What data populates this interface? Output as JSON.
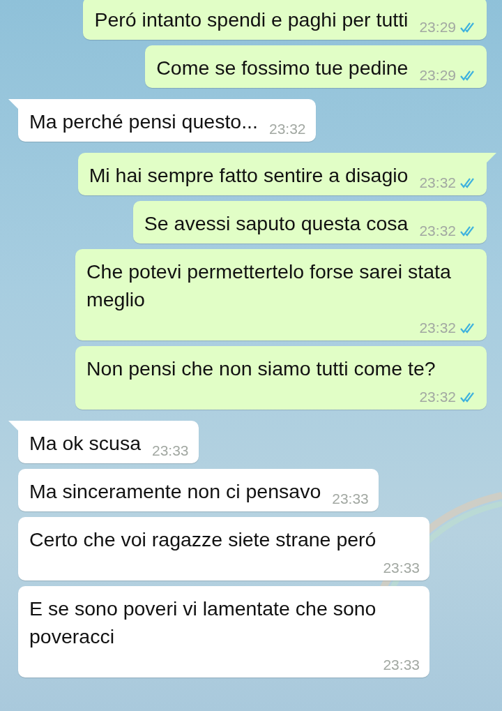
{
  "messages": [
    {
      "kind": "outgoing",
      "tail": false,
      "text": "Peró intanto spendi e paghi per tutti",
      "time": "23:29",
      "read": true
    },
    {
      "kind": "outgoing",
      "tail": false,
      "text": "Come se fossimo tue pedine",
      "time": "23:29",
      "read": true
    },
    {
      "kind": "incoming",
      "tail": true,
      "text": "Ma perché pensi questo...",
      "time": "23:32"
    },
    {
      "kind": "outgoing",
      "tail": true,
      "text": "Mi hai sempre fatto sentire a disagio",
      "time": "23:32",
      "read": true
    },
    {
      "kind": "outgoing",
      "tail": false,
      "text": "Se avessi saputo questa cosa",
      "time": "23:32",
      "read": true
    },
    {
      "kind": "outgoing",
      "tail": false,
      "text": "Che potevi permettertelo forse sarei stata meglio",
      "time": "23:32",
      "read": true
    },
    {
      "kind": "outgoing",
      "tail": false,
      "text": "Non pensi che non siamo tutti come te?",
      "time": "23:32",
      "read": true
    },
    {
      "kind": "incoming",
      "tail": true,
      "text": "Ma ok scusa",
      "time": "23:33"
    },
    {
      "kind": "incoming",
      "tail": false,
      "text": "Ma sinceramente non ci pensavo",
      "time": "23:33"
    },
    {
      "kind": "incoming",
      "tail": false,
      "text": "Certo che voi ragazze siete strane peró",
      "time": "23:33"
    },
    {
      "kind": "incoming",
      "tail": false,
      "text": "E se sono poveri vi lamentate che sono poveracci",
      "time": "23:33"
    }
  ]
}
